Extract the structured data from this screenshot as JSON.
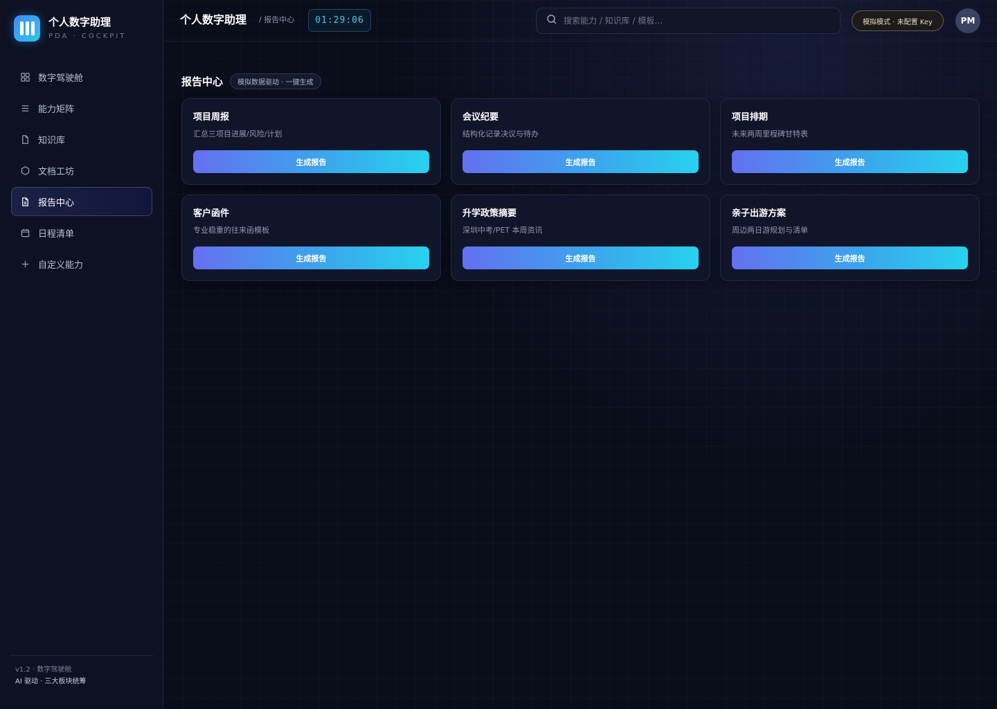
{
  "app": {
    "title": "个人数字助理",
    "subtitle": "PDA · COCKPIT"
  },
  "sidebar": {
    "items": [
      {
        "label": "数字驾驶舱",
        "icon": "grid-icon"
      },
      {
        "label": "能力矩阵",
        "icon": "list-icon"
      },
      {
        "label": "知识库",
        "icon": "document-icon"
      },
      {
        "label": "文档工坊",
        "icon": "hexagon-icon"
      },
      {
        "label": "报告中心",
        "icon": "report-icon",
        "active": true
      },
      {
        "label": "日程清单",
        "icon": "calendar-icon"
      },
      {
        "label": "自定义能力",
        "icon": "plus-icon"
      }
    ],
    "footer": {
      "version": "v1.2 · 数字驾驶舱",
      "tagline": "AI 驱动 · 三大板块统筹"
    }
  },
  "topbar": {
    "title": "个人数字助理",
    "breadcrumb": "/ 报告中心",
    "clock": "01:29:06",
    "search_placeholder": "搜索能力 / 知识库 / 模板…",
    "mode_badge": "模拟模式 · 未配置 Key",
    "avatar": "PM"
  },
  "section": {
    "title": "报告中心",
    "tag": "模拟数据驱动 · 一键生成"
  },
  "cards": [
    {
      "title": "项目周报",
      "desc": "汇总三项目进展/风险/计划",
      "button": "生成报告"
    },
    {
      "title": "会议纪要",
      "desc": "结构化记录决议与待办",
      "button": "生成报告"
    },
    {
      "title": "项目排期",
      "desc": "未来两周里程碑甘特表",
      "button": "生成报告"
    },
    {
      "title": "客户函件",
      "desc": "专业稳重的往来函模板",
      "button": "生成报告"
    },
    {
      "title": "升学政策摘要",
      "desc": "深圳中考/PET 本周资讯",
      "button": "生成报告"
    },
    {
      "title": "亲子出游方案",
      "desc": "周边两日游规划与清单",
      "button": "生成报告"
    }
  ],
  "colors": {
    "accent": "#47c7ee",
    "button_gradient_start": "#6470f0",
    "button_gradient_end": "#28d1ee",
    "background": "#0a0d1a"
  }
}
